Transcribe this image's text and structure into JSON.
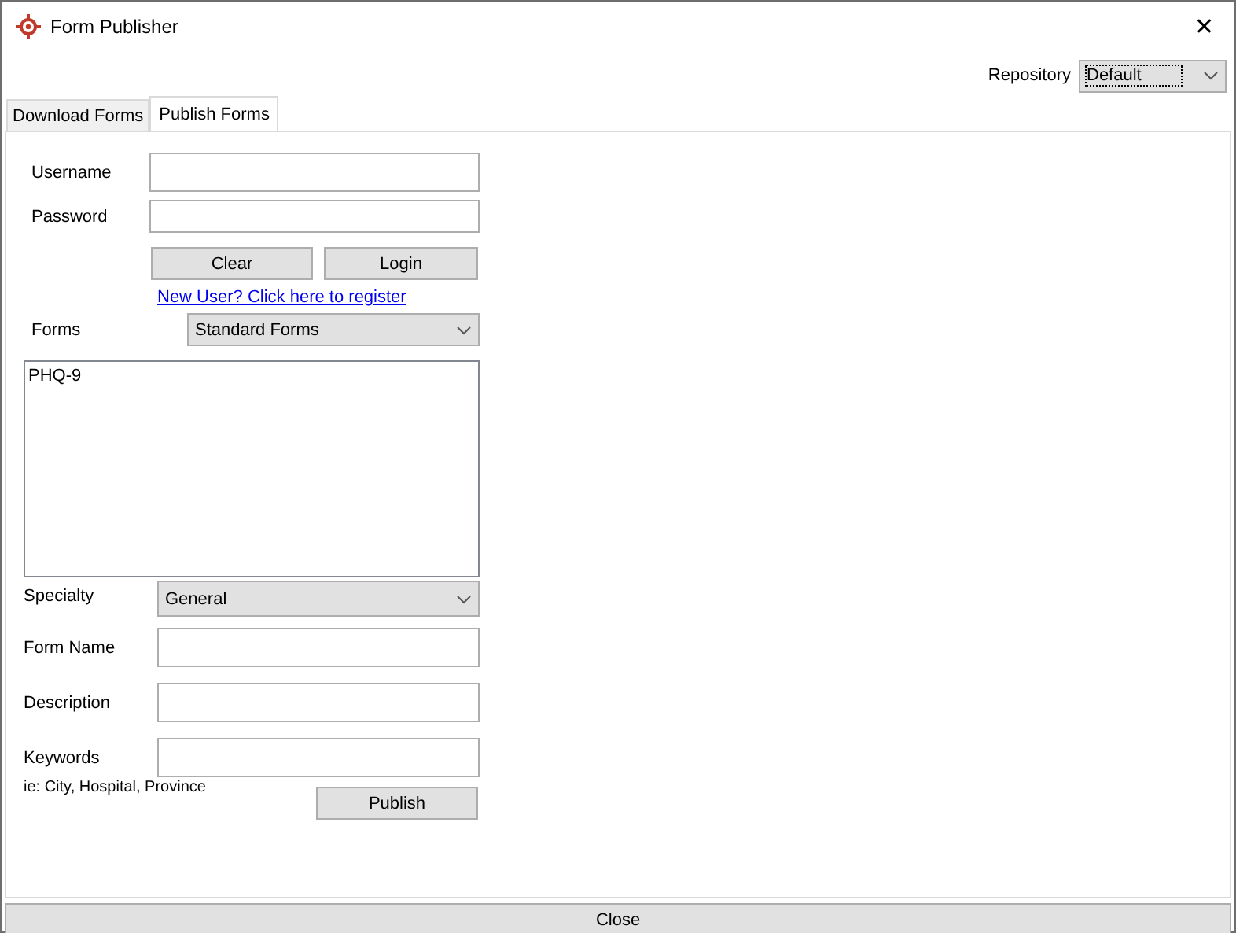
{
  "window": {
    "title": "Form Publisher",
    "close_glyph": "✕"
  },
  "repository": {
    "label": "Repository",
    "value": "Default"
  },
  "tabs": [
    {
      "label": "Download Forms",
      "selected": false
    },
    {
      "label": "Publish Forms",
      "selected": true
    }
  ],
  "login": {
    "username_label": "Username",
    "password_label": "Password",
    "clear_button": "Clear",
    "login_button": "Login",
    "register_link": "New User? Click here to register"
  },
  "forms": {
    "label": "Forms",
    "value": "Standard Forms",
    "items": [
      "PHQ-9"
    ]
  },
  "publish": {
    "specialty_label": "Specialty",
    "specialty_value": "General",
    "form_name_label": "Form Name",
    "description_label": "Description",
    "keywords_label": "Keywords",
    "keywords_hint": "ie: City, Hospital, Province",
    "publish_button": "Publish"
  },
  "close_button": "Close"
}
